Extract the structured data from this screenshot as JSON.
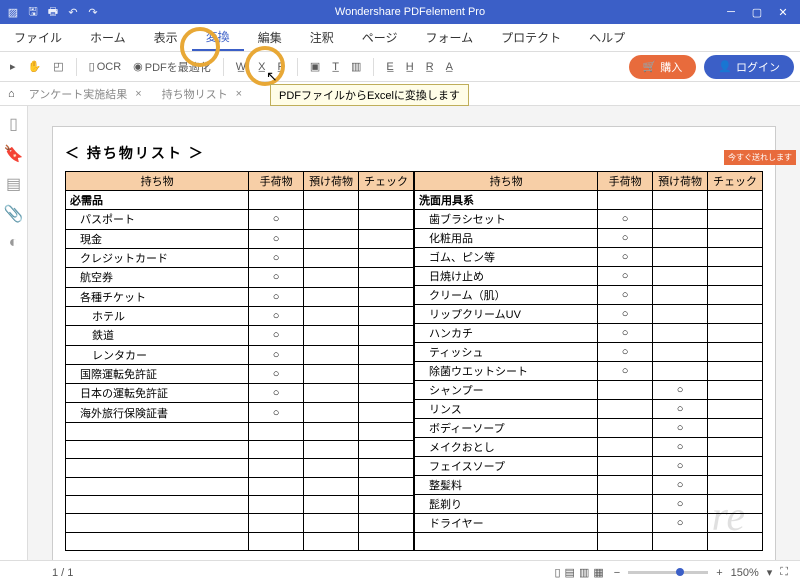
{
  "app": {
    "title": "Wondershare PDFelement Pro"
  },
  "menus": [
    "ファイル",
    "ホーム",
    "表示",
    "変換",
    "編集",
    "注釈",
    "ページ",
    "フォーム",
    "プロテクト",
    "ヘルプ"
  ],
  "active_menu": 3,
  "toolbar": {
    "ocr": "OCR",
    "optimize": "PDFを最適化",
    "buy": "購入",
    "login": "ログイン"
  },
  "tabs": [
    "アンケート実施結果",
    "持ち物リスト"
  ],
  "tooltip": "PDFファイルからExcelに変換します",
  "side_tag": "今すぐ送れします",
  "page": {
    "title": "持ち物リスト"
  },
  "headers": [
    "持ち物",
    "手荷物",
    "預け荷物",
    "チェック"
  ],
  "left_rows": [
    {
      "lbl": "必需品",
      "sect": true
    },
    {
      "lbl": "パスポート",
      "ind": 1,
      "c2": "○"
    },
    {
      "lbl": "現金",
      "ind": 1,
      "c2": "○"
    },
    {
      "lbl": "クレジットカード",
      "ind": 1,
      "c2": "○"
    },
    {
      "lbl": "航空券",
      "ind": 1,
      "c2": "○"
    },
    {
      "lbl": "各種チケット",
      "ind": 1,
      "c2": "○"
    },
    {
      "lbl": "ホテル",
      "ind": 2,
      "c2": "○"
    },
    {
      "lbl": "鉄道",
      "ind": 2,
      "c2": "○"
    },
    {
      "lbl": "レンタカー",
      "ind": 2,
      "c2": "○"
    },
    {
      "lbl": "国際運転免許証",
      "ind": 1,
      "c2": "○"
    },
    {
      "lbl": "日本の運転免許証",
      "ind": 1,
      "c2": "○"
    },
    {
      "lbl": "海外旅行保険証書",
      "ind": 1,
      "c2": "○"
    },
    {
      "lbl": ""
    },
    {
      "lbl": ""
    },
    {
      "lbl": ""
    },
    {
      "lbl": ""
    },
    {
      "lbl": ""
    },
    {
      "lbl": ""
    },
    {
      "lbl": ""
    }
  ],
  "right_rows": [
    {
      "lbl": "洗面用具系",
      "sect": true
    },
    {
      "lbl": "歯ブラシセット",
      "ind": 1,
      "c2": "○"
    },
    {
      "lbl": "化粧用品",
      "ind": 1,
      "c2": "○"
    },
    {
      "lbl": "ゴム、ピン等",
      "ind": 1,
      "c2": "○"
    },
    {
      "lbl": "日焼け止め",
      "ind": 1,
      "c2": "○"
    },
    {
      "lbl": "クリーム（肌）",
      "ind": 1,
      "c2": "○"
    },
    {
      "lbl": "リップクリームUV",
      "ind": 1,
      "c2": "○"
    },
    {
      "lbl": "ハンカチ",
      "ind": 1,
      "c2": "○"
    },
    {
      "lbl": "ティッシュ",
      "ind": 1,
      "c2": "○"
    },
    {
      "lbl": "除菌ウエットシート",
      "ind": 1,
      "c2": "○"
    },
    {
      "lbl": "シャンプー",
      "ind": 1,
      "c3": "○"
    },
    {
      "lbl": "リンス",
      "ind": 1,
      "c3": "○"
    },
    {
      "lbl": "ボディーソープ",
      "ind": 1,
      "c3": "○"
    },
    {
      "lbl": "メイクおとし",
      "ind": 1,
      "c3": "○"
    },
    {
      "lbl": "フェイスソープ",
      "ind": 1,
      "c3": "○"
    },
    {
      "lbl": "整髪料",
      "ind": 1,
      "c3": "○"
    },
    {
      "lbl": "髭剃り",
      "ind": 1,
      "c3": "○"
    },
    {
      "lbl": "ドライヤー",
      "ind": 1,
      "c3": "○"
    },
    {
      "lbl": ""
    }
  ],
  "status": {
    "page": "1",
    "total": "1",
    "zoom": "150%"
  }
}
